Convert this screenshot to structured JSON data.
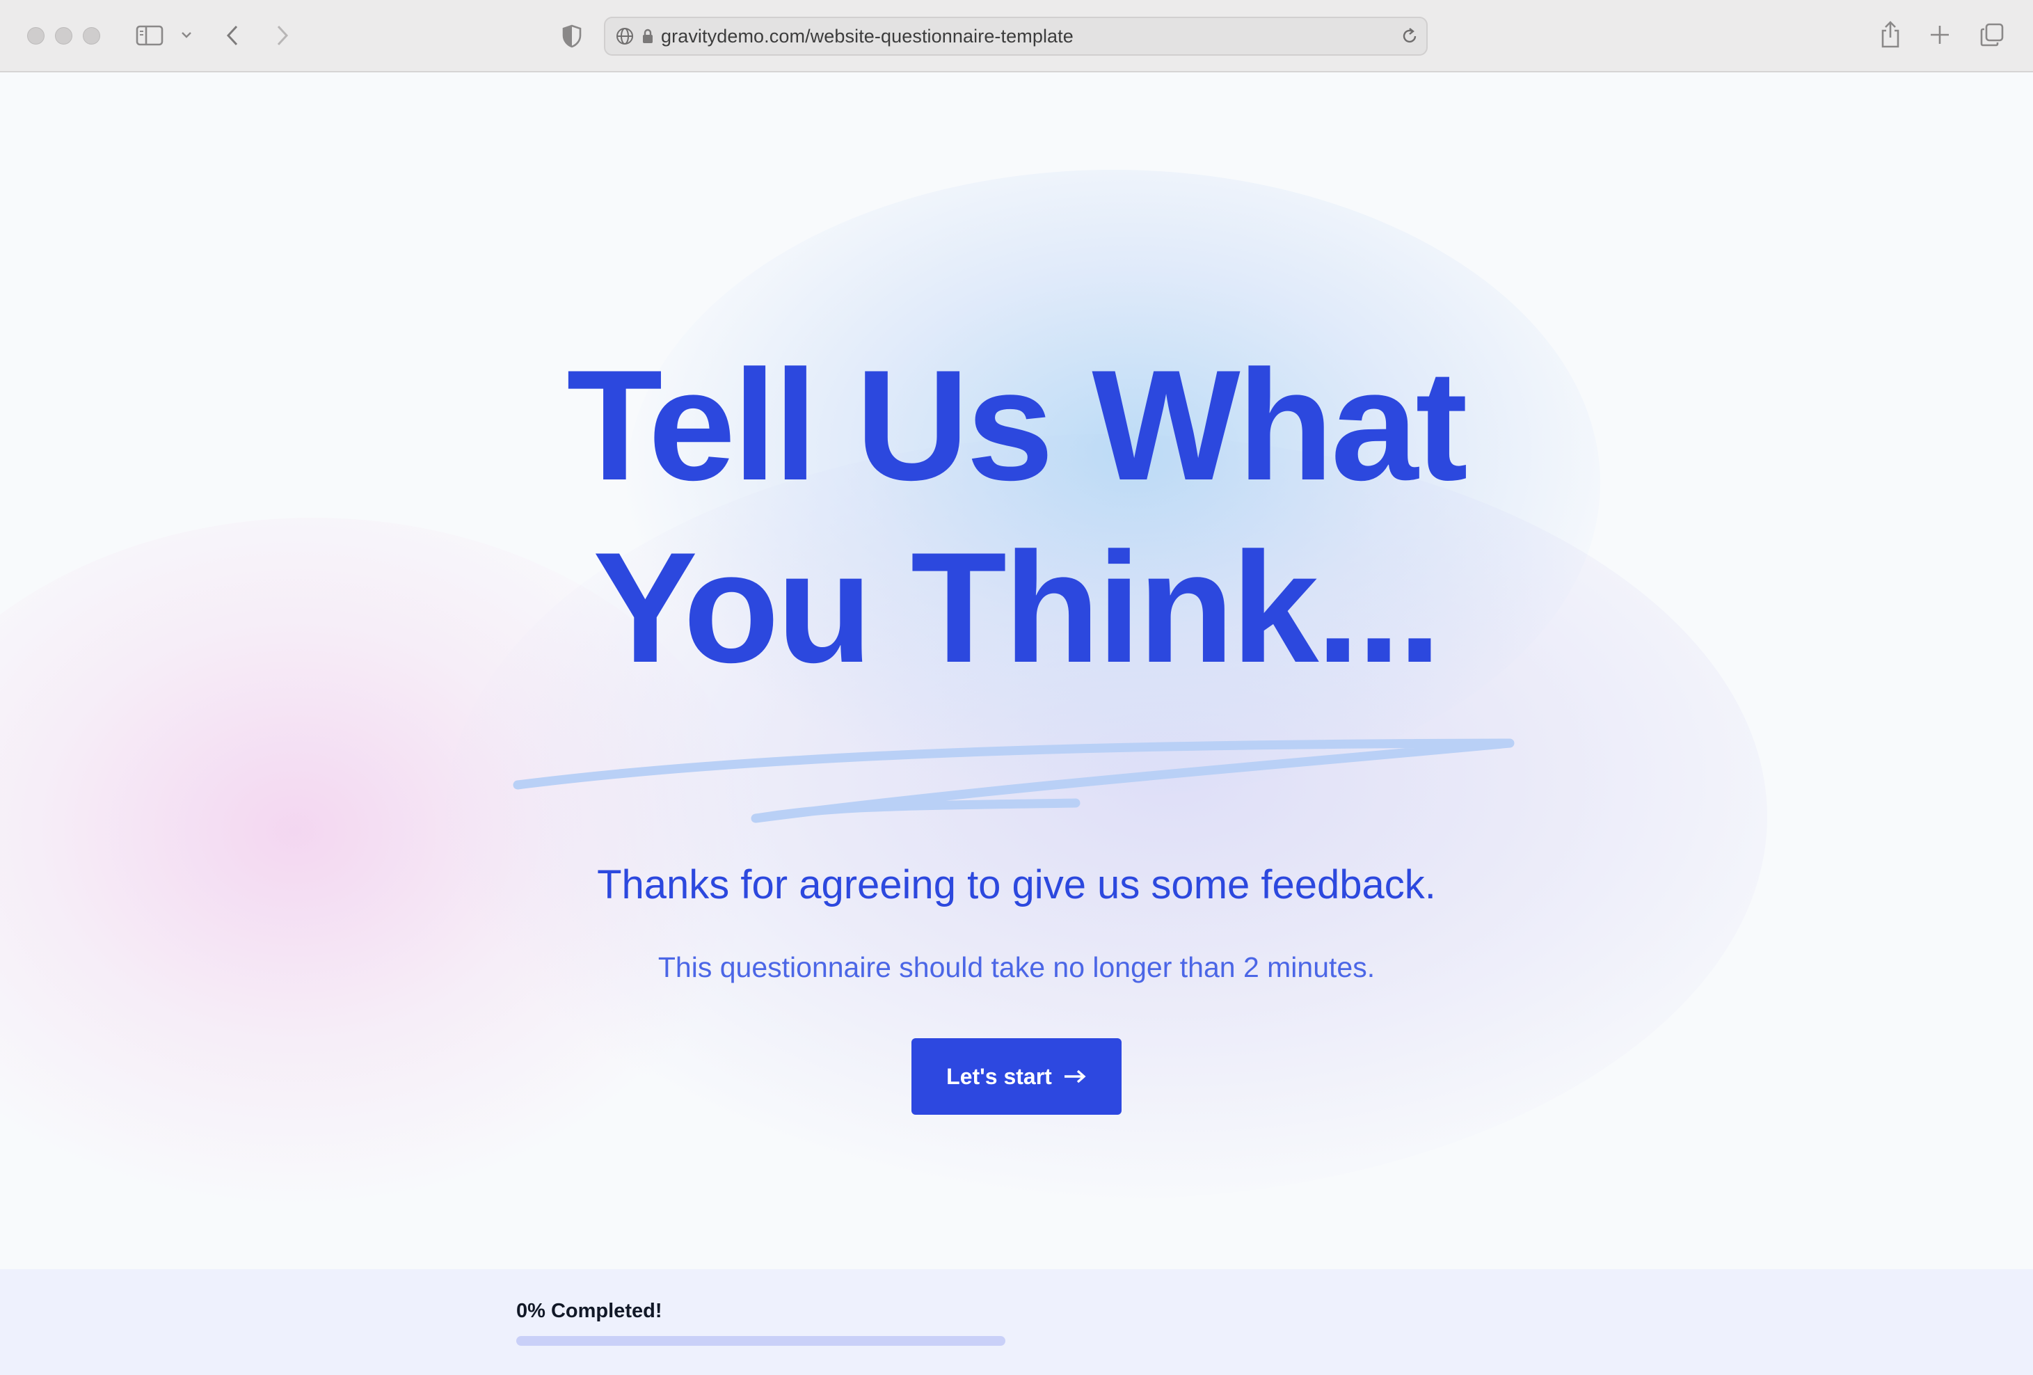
{
  "browser": {
    "url": "gravitydemo.com/website-questionnaire-template",
    "icons": {
      "sidebar": "sidebar-icon",
      "back": "chevron-left-icon",
      "forward": "chevron-right-icon",
      "privacy": "shield-icon",
      "site": "globe-icon",
      "secure": "lock-icon",
      "reload": "reload-icon",
      "share": "share-icon",
      "new_tab": "plus-icon",
      "tabs": "tabs-overview-icon"
    }
  },
  "hero": {
    "headline_line1": "Tell Us What",
    "headline_line2": "You Think...",
    "lead": "Thanks for agreeing to give us some feedback.",
    "sub": "This questionnaire should take no longer than 2 minutes.",
    "cta_label": "Let's start"
  },
  "progress": {
    "label": "0% Completed!",
    "percent": 0
  },
  "colors": {
    "brand": "#2c48de",
    "button": "#2d48e0",
    "scribble": "#b9d0f6",
    "progress_track": "#c9d0f8"
  }
}
